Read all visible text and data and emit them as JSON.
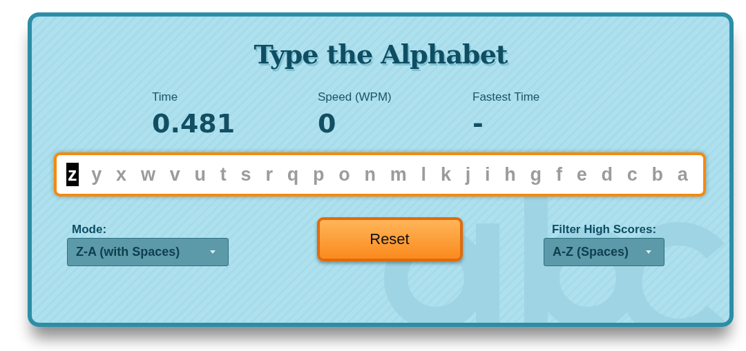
{
  "title": "Type the Alphabet",
  "stats": [
    {
      "label": "Time",
      "value": "0.481"
    },
    {
      "label": "Speed (WPM)",
      "value": "0"
    },
    {
      "label": "Fastest Time",
      "value": "-"
    }
  ],
  "letters": [
    {
      "char": "z",
      "current": true
    },
    {
      "char": "y",
      "current": false
    },
    {
      "char": "x",
      "current": false
    },
    {
      "char": "w",
      "current": false
    },
    {
      "char": "v",
      "current": false
    },
    {
      "char": "u",
      "current": false
    },
    {
      "char": "t",
      "current": false
    },
    {
      "char": "s",
      "current": false
    },
    {
      "char": "r",
      "current": false
    },
    {
      "char": "q",
      "current": false
    },
    {
      "char": "p",
      "current": false
    },
    {
      "char": "o",
      "current": false
    },
    {
      "char": "n",
      "current": false
    },
    {
      "char": "m",
      "current": false
    },
    {
      "char": "l",
      "current": false
    },
    {
      "char": "k",
      "current": false
    },
    {
      "char": "j",
      "current": false
    },
    {
      "char": "i",
      "current": false
    },
    {
      "char": "h",
      "current": false
    },
    {
      "char": "g",
      "current": false
    },
    {
      "char": "f",
      "current": false
    },
    {
      "char": "e",
      "current": false
    },
    {
      "char": "d",
      "current": false
    },
    {
      "char": "c",
      "current": false
    },
    {
      "char": "b",
      "current": false
    },
    {
      "char": "a",
      "current": false
    }
  ],
  "mode": {
    "label": "Mode:",
    "value": "Z-A (with Spaces)"
  },
  "reset_button": "Reset",
  "filter": {
    "label": "Filter High Scores:",
    "value": "A-Z (Spaces)"
  }
}
